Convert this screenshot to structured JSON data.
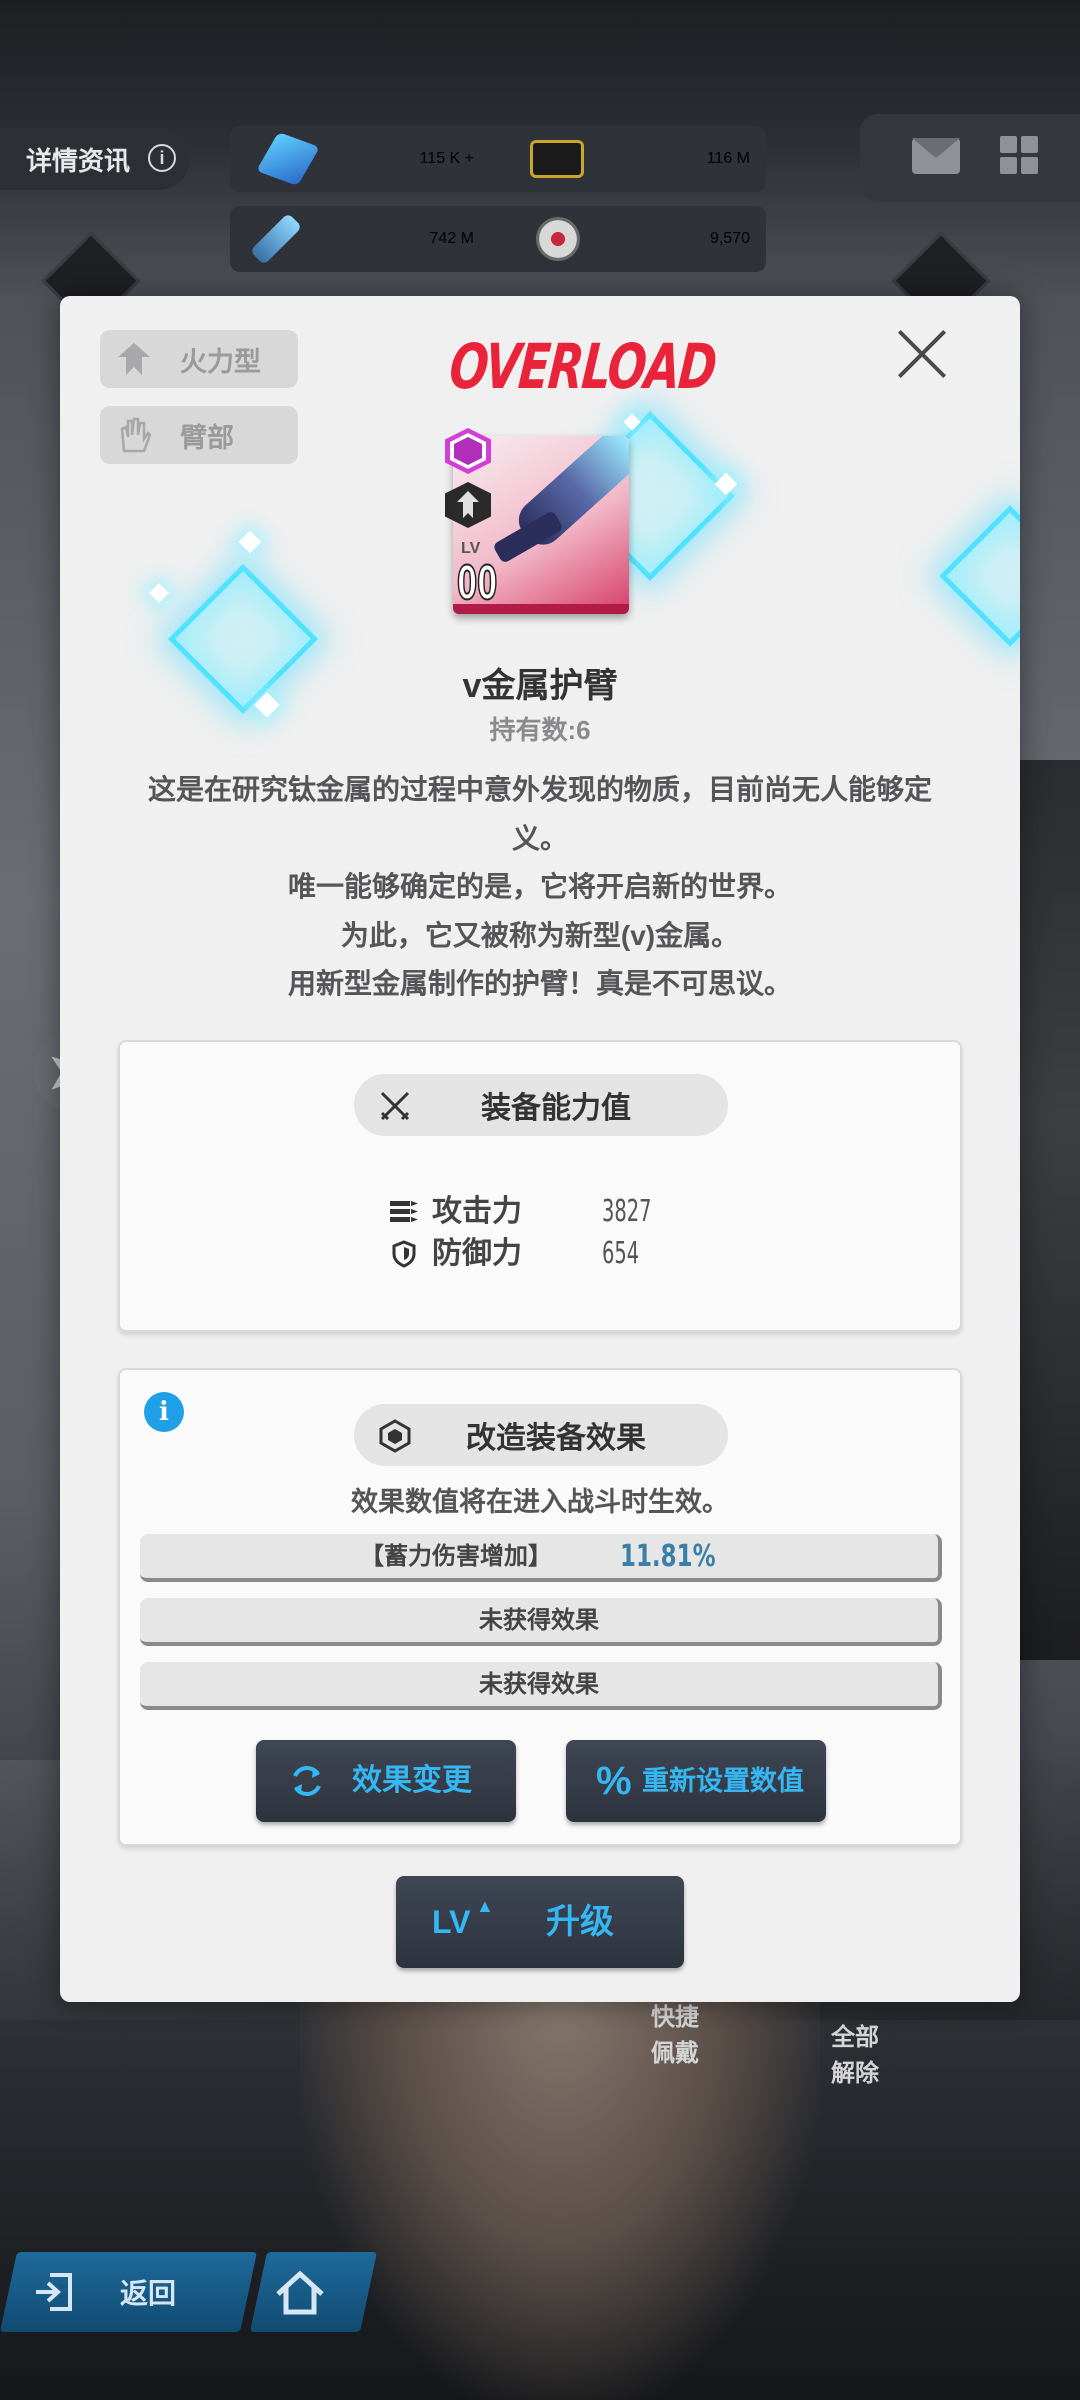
{
  "hud": {
    "detail_label": "详情资讯",
    "resources": [
      {
        "icon": "gem-icon",
        "value": "115 K +"
      },
      {
        "icon": "credit-case-icon",
        "value": "116 M"
      },
      {
        "icon": "core-dust-icon",
        "value": "742 M"
      },
      {
        "icon": "battle-data-icon",
        "value": "9,570"
      }
    ]
  },
  "modal": {
    "tags": [
      {
        "icon": "firepower-type-icon",
        "label": "火力型"
      },
      {
        "icon": "arm-part-icon",
        "label": "臂部"
      }
    ],
    "brand": "OVERLOAD",
    "item": {
      "level_label": "LV",
      "level": "00",
      "name": "v金属护臂",
      "owned": "持有数:6"
    },
    "description": [
      "这是在研究钛金属的过程中意外发现的物质，目前尚无人能够定",
      "义。",
      "唯一能够确定的是，它将开启新的世界。",
      "为此，它又被称为新型(v)金属。",
      "用新型金属制作的护臂！真是不可思议。"
    ],
    "stats": {
      "title": "装备能力值",
      "rows": [
        {
          "icon": "attack-icon",
          "label": "攻击力",
          "value": "3827"
        },
        {
          "icon": "defense-shield-icon",
          "label": "防御力",
          "value": "654"
        }
      ]
    },
    "effects": {
      "title": "改造装备效果",
      "note": "效果数值将在进入战斗时生效。",
      "slots": [
        {
          "label": "【蓄力伤害增加】",
          "value": "11.81%"
        },
        {
          "label": "未获得效果",
          "value": ""
        },
        {
          "label": "未获得效果",
          "value": ""
        }
      ],
      "change_button": "效果变更",
      "reset_button": "重新设置数值"
    },
    "upgrade": {
      "lv": "LV",
      "label": "升级"
    }
  },
  "background": {
    "quick_equip": "快捷\n佩戴",
    "unequip_all": "全部\n解除",
    "back": "返回"
  },
  "colors": {
    "accent_red": "#e8233a",
    "accent_blue": "#34b7f2",
    "info_blue": "#1e9fe6",
    "glow_cyan": "#4fe3ff"
  }
}
